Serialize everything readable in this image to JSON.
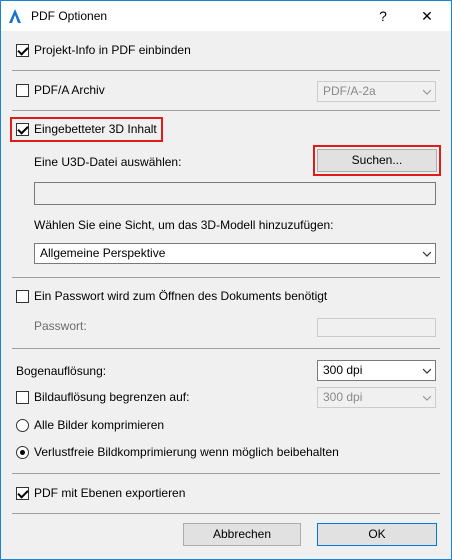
{
  "window": {
    "title": "PDF Optionen",
    "help": "?",
    "close": "✕"
  },
  "project_info": {
    "label": "Projekt-Info in PDF einbinden",
    "checked": true
  },
  "pdfa": {
    "label": "PDF/A Archiv",
    "checked": false,
    "select_value": "PDF/A-2a"
  },
  "embed3d": {
    "label": "Eingebetteter 3D Inhalt",
    "checked": true
  },
  "u3d": {
    "label": "Eine U3D-Datei auswählen:",
    "button": "Suchen...",
    "path_value": ""
  },
  "view": {
    "label": "Wählen Sie eine Sicht, um das 3D-Modell hinzuzufügen:",
    "select_value": "Allgemeine Perspektive"
  },
  "password": {
    "checkbox_label": "Ein Passwort wird zum Öffnen des Dokuments benötigt",
    "checked": false,
    "field_label": "Passwort:",
    "value": ""
  },
  "arc": {
    "label": "Bogenauflösung:",
    "select_value": "300 dpi"
  },
  "image_limit": {
    "label": "Bildauflösung begrenzen auf:",
    "checked": false,
    "select_value": "300 dpi"
  },
  "compress_all": {
    "label": "Alle Bilder komprimieren",
    "selected": false
  },
  "lossless": {
    "label": "Verlustfreie Bildkomprimierung wenn möglich beibehalten",
    "selected": true
  },
  "layers": {
    "label": "PDF mit Ebenen exportieren",
    "checked": true
  },
  "buttons": {
    "cancel": "Abbrechen",
    "ok": "OK"
  },
  "colors": {
    "highlight": "#e11a1a",
    "window_border": "#1883d7",
    "default_button_border": "#0078d7"
  }
}
